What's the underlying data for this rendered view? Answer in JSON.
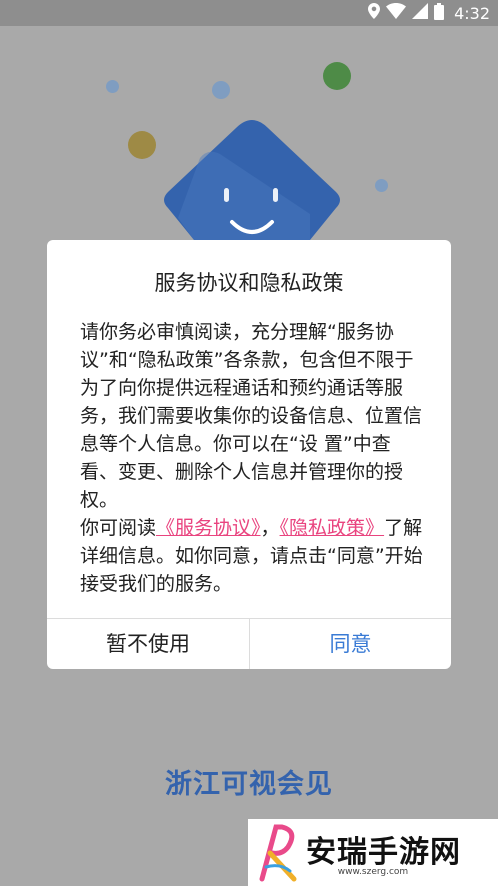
{
  "status_bar": {
    "time": "4:32",
    "icons": [
      "location-icon",
      "wifi-icon",
      "signal-icon",
      "battery-icon"
    ]
  },
  "colors": {
    "brand_blue": "#3463ad",
    "link_pink": "#e9447f",
    "accent_blue": "#3a7bd5"
  },
  "app": {
    "name": "浙江可视会见"
  },
  "dialog": {
    "title": "服务协议和隐私政策",
    "body_text_1": "请你务必审慎阅读，充分理解“服务协议”和“隐私政策”各条款，包含但不限于为了向你提供远程通话和预约通话等服务，我们需要收集你的设备信息、位置信息等个人信息。你可以在“设 置”中查看、变更、删除个人信息并管理你的授权。",
    "body_text_2_prefix": "你可阅读",
    "link_service": "《服务协议》",
    "separator": "，",
    "link_privacy": "《隐私政策》",
    "body_text_2_suffix": "了解详细信息。如你同意，请点击“同意”开始接受我们的服务。",
    "decline_label": "暂不使用",
    "agree_label": "同意"
  },
  "watermark": {
    "text": "安瑞手游网",
    "url": "www.szerg.com"
  }
}
